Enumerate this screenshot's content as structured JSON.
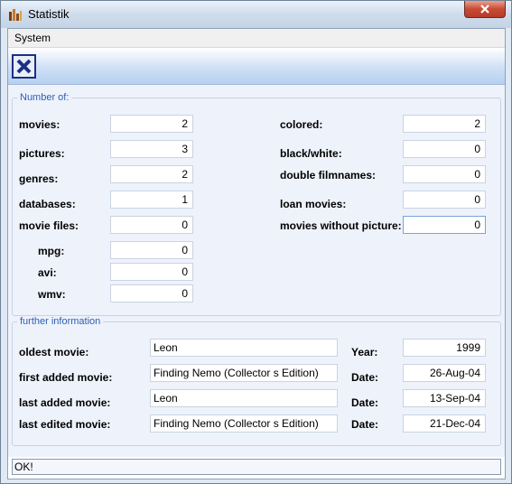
{
  "window": {
    "title": "Statistik"
  },
  "menu": {
    "system": "System"
  },
  "group_number": {
    "title": "Number of:",
    "left": [
      {
        "label": "movies:",
        "value": "2"
      },
      {
        "label": "pictures:",
        "value": "3"
      },
      {
        "label": "genres:",
        "value": "2"
      },
      {
        "label": "databases:",
        "value": "1"
      },
      {
        "label": "movie files:",
        "value": "0"
      },
      {
        "label": "mpg:",
        "value": "0"
      },
      {
        "label": "avi:",
        "value": "0"
      },
      {
        "label": "wmv:",
        "value": "0"
      }
    ],
    "right": [
      {
        "label": "colored:",
        "value": "2"
      },
      {
        "label": "black/white:",
        "value": "0"
      },
      {
        "label": "double filmnames:",
        "value": "0"
      },
      {
        "label": "loan movies:",
        "value": "0"
      },
      {
        "label": "movies without picture:",
        "value": "0"
      }
    ]
  },
  "group_info": {
    "title": "further information",
    "rows": [
      {
        "label": "oldest movie:",
        "value": "Leon",
        "date_label": "Year:",
        "date": "1999"
      },
      {
        "label": "first added movie:",
        "value": "Finding Nemo (Collector s Edition)",
        "date_label": "Date:",
        "date": "26-Aug-04"
      },
      {
        "label": "last added movie:",
        "value": "Leon",
        "date_label": "Date:",
        "date": "13-Sep-04"
      },
      {
        "label": "last edited movie:",
        "value": "Finding Nemo (Collector s Edition)",
        "date_label": "Date:",
        "date": "21-Dec-04"
      }
    ]
  },
  "status": {
    "text": "OK!"
  }
}
